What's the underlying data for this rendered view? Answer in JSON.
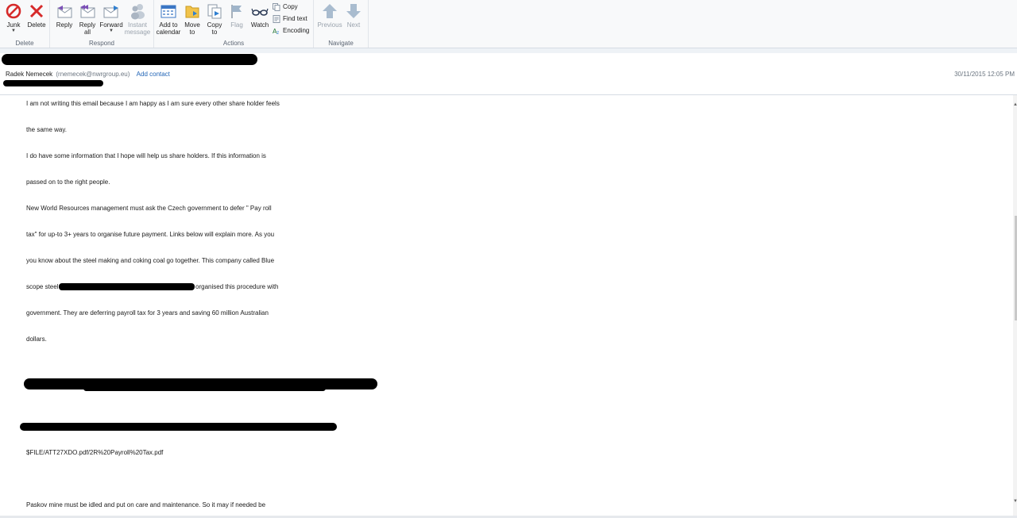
{
  "ribbon": {
    "groups": {
      "delete": "Delete",
      "respond": "Respond",
      "actions": "Actions",
      "navigate": "Navigate"
    },
    "buttons": {
      "junk": "Junk",
      "delete": "Delete",
      "reply": "Reply",
      "reply_all_1": "Reply",
      "reply_all_2": "all",
      "forward": "Forward",
      "im_1": "Instant",
      "im_2": "message",
      "add_cal_1": "Add to",
      "add_cal_2": "calendar",
      "move_1": "Move",
      "move_2": "to",
      "copy_1": "Copy",
      "copy_2": "to",
      "flag": "Flag",
      "watch": "Watch",
      "copy_small": "Copy",
      "find_text": "Find text",
      "encoding": "Encoding",
      "previous": "Previous",
      "next": "Next"
    }
  },
  "message": {
    "sender_name": "Radek Nemecek",
    "sender_email": "(rnemecek@nwrgroup.eu)",
    "add_contact": "Add contact",
    "date": "30/11/2015 12:05 PM",
    "paragraphs": [
      "I am not writing this email because I am happy as I am sure every other share holder feels",
      "the same way.",
      "I do have some information that I hope will help us share holders. If this information is",
      "passed on to the right people.",
      "New World Resources management must ask the Czech government to defer \" Pay roll",
      "tax\" for up-to 3+ years to organise future payment. Links below will explain more. As you",
      "you know about the steel making and coking coal go together. This company called Blue",
      "scope steel",
      "organised this procedure with",
      "government. They are deferring payroll tax for 3 years and saving 60 million Australian",
      "dollars.",
      "$FILE/ATT27XDO.pdf/2R%20Payroll%20Tax.pdf",
      "Paskov mine must be idled and put on care and maintenance. So it may if needed be"
    ]
  },
  "colors": {
    "accent_link": "#1f63b5",
    "ribbon_bg": "#f8f9fa",
    "redaction": "#000000"
  }
}
